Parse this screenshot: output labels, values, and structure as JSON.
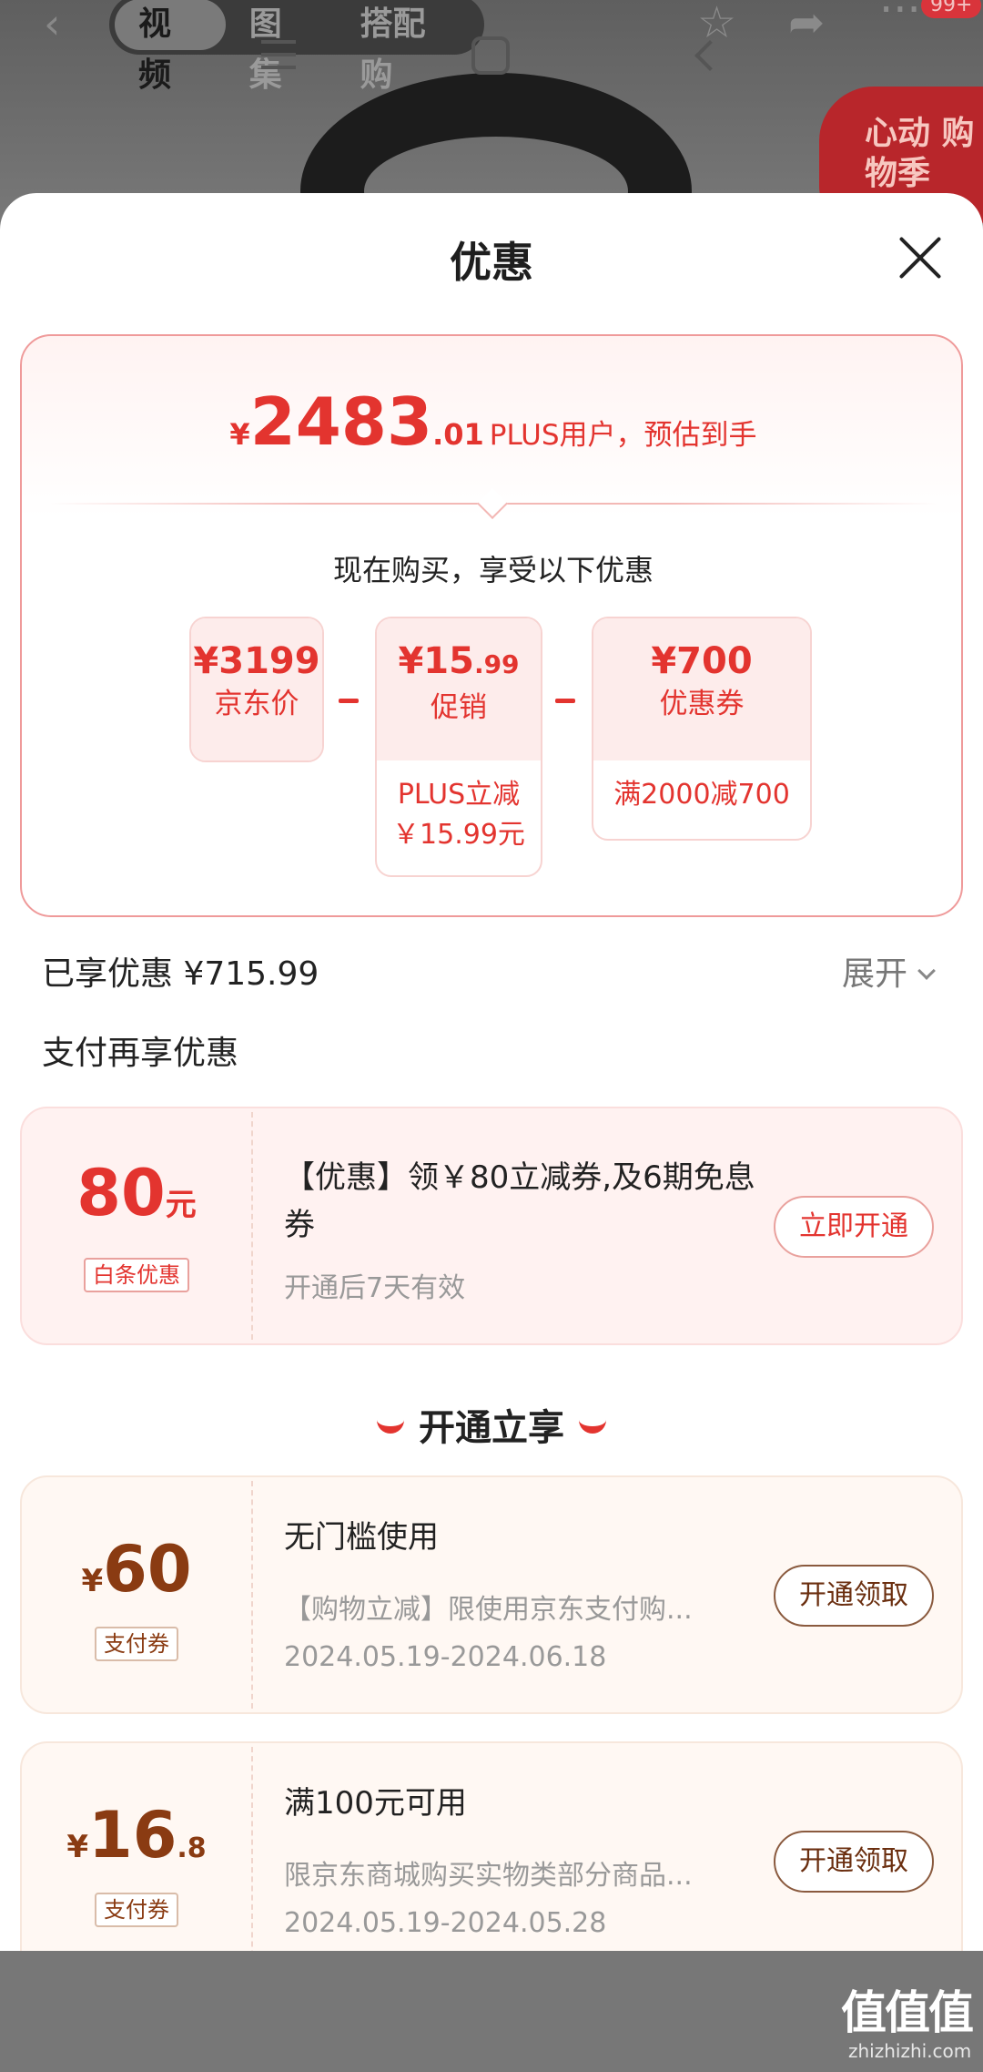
{
  "background": {
    "tabs": [
      "视频",
      "图集",
      "搭配购"
    ],
    "active_tab": "视频",
    "badge_text": "心动 购物季",
    "more_badge": "99+"
  },
  "sheet": {
    "title": "优惠",
    "estimate": {
      "currency": "¥",
      "integer": "2483",
      "decimal": ".01",
      "label": "PLUS用户，预估到手"
    },
    "enjoy_text": "现在购买，享受以下优惠",
    "breakdown": [
      {
        "value": "¥3199",
        "value_small": "",
        "label": "京东价",
        "detail": ""
      },
      {
        "value": "¥15",
        "value_small": ".99",
        "label": "促销",
        "detail": "PLUS立减\n￥15.99元"
      },
      {
        "value": "¥700",
        "value_small": "",
        "label": "优惠券",
        "detail": "满2000减700"
      }
    ],
    "enjoyed": "已享优惠 ¥715.99",
    "expand_label": "展开",
    "pay_title": "支付再享优惠",
    "baitiao": {
      "amount": "80",
      "unit": "元",
      "tag": "白条优惠",
      "title": "【优惠】领￥80立减券,及6期免息券",
      "desc": "开通后7天有效",
      "button": "立即开通"
    },
    "section_title": "开通立享",
    "coupons": [
      {
        "symbol": "¥",
        "amount": "60",
        "amount_small": "",
        "tag": "支付券",
        "title": "无门槛使用",
        "desc": "【购物立减】限使用京东支付购...",
        "date": "2024.05.19-2024.06.18",
        "button": "开通领取"
      },
      {
        "symbol": "¥",
        "amount": "16",
        "amount_small": ".8",
        "tag": "支付券",
        "title": "满100元可用",
        "desc": "限京东商城购买实物类部分商品...",
        "date": "2024.05.19-2024.05.28",
        "button": "开通领取"
      }
    ]
  },
  "watermark": {
    "main": "值值值",
    "sub": "zhizhizhi.com"
  },
  "colors": {
    "accent": "#e3342f",
    "coupon_brown": "#8a3b12",
    "sheet_bg": "#ffffff"
  }
}
